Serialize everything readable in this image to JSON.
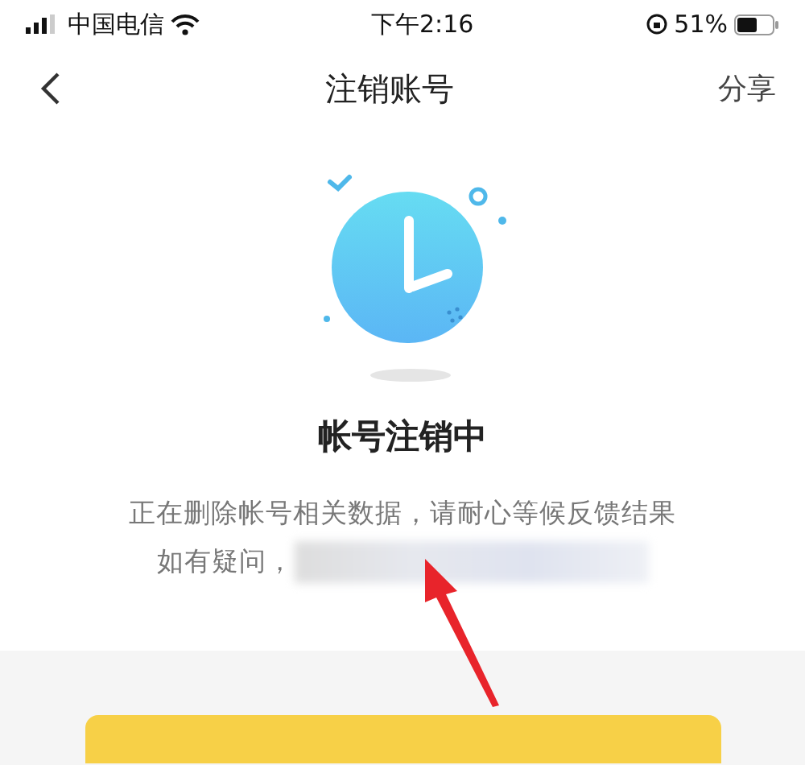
{
  "status_bar": {
    "carrier": "中国电信",
    "time": "下午2:16",
    "battery": "51%"
  },
  "nav": {
    "title": "注销账号",
    "action": "分享"
  },
  "status": {
    "title": "帐号注销中",
    "message": "正在删除帐号相关数据，请耐心等候反馈结果",
    "help_prefix": "如有疑问，"
  }
}
